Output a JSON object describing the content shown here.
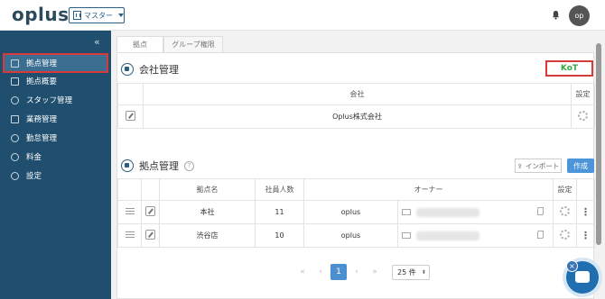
{
  "header": {
    "logo": "oplus",
    "master_select": "マスター",
    "avatar_initials": "op"
  },
  "sidebar": {
    "items": [
      {
        "label": "拠点管理",
        "icon": "building-icon",
        "active": true
      },
      {
        "label": "拠点概要",
        "icon": "document-icon"
      },
      {
        "label": "スタッフ管理",
        "icon": "person-icon"
      },
      {
        "label": "業務管理",
        "icon": "calendar-icon"
      },
      {
        "label": "勤怠管理",
        "icon": "clock-icon"
      },
      {
        "label": "料金",
        "icon": "yen-icon"
      },
      {
        "label": "設定",
        "icon": "gear-icon"
      }
    ]
  },
  "tabs": [
    {
      "label": "拠点",
      "active": true
    },
    {
      "label": "グループ権限",
      "active": false
    }
  ],
  "company_section": {
    "title": "会社管理",
    "kot_label": "KoT",
    "columns": [
      "会社",
      "設定"
    ],
    "rows": [
      {
        "company": "Oplus株式会社"
      }
    ]
  },
  "branch_section": {
    "title": "拠点管理",
    "help": "?",
    "import_label": "インポート",
    "create_label": "作成",
    "columns": [
      "拠点名",
      "社員人数",
      "オーナー",
      "設定"
    ],
    "rows": [
      {
        "name": "本社",
        "count": "11",
        "owner": "oplus"
      },
      {
        "name": "渋谷店",
        "count": "10",
        "owner": "oplus"
      }
    ]
  },
  "pagination": {
    "first": "«",
    "prev": "‹",
    "current": "1",
    "next": "›",
    "last": "»",
    "per_page": "25 件"
  },
  "colors": {
    "sidebar_bg": "#1f4e6e",
    "accent_blue": "#4b95d8",
    "highlight_red": "#d83a3a",
    "kot_green": "#35a845"
  }
}
